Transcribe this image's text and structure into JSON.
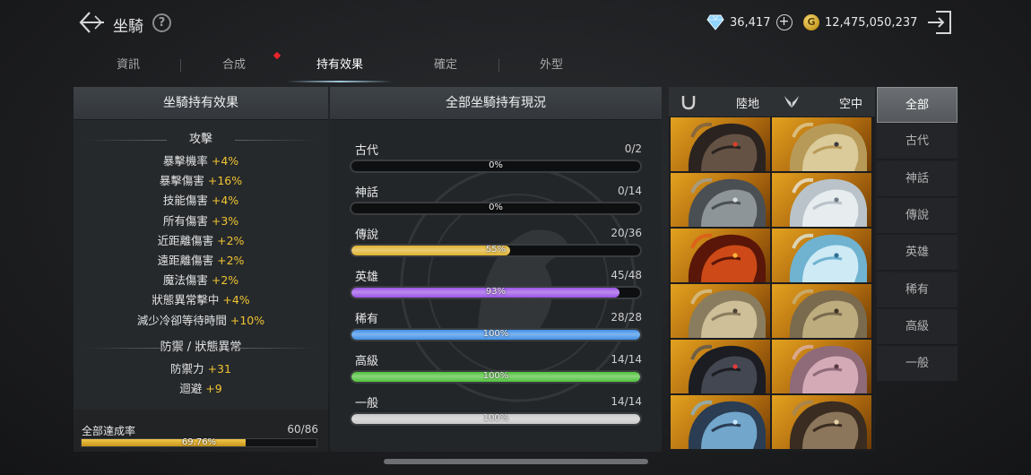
{
  "header": {
    "title": "坐騎",
    "help_symbol": "?",
    "diamond_value": "36,417",
    "gold_symbol": "G",
    "gold_value": "12,475,050,237"
  },
  "tabs": [
    {
      "label": "資訊"
    },
    {
      "label": "合成"
    },
    {
      "label": "持有效果"
    },
    {
      "label": "確定"
    },
    {
      "label": "外型"
    }
  ],
  "active_tab": "持有效果",
  "left_panel": {
    "title": "坐騎持有效果",
    "sections": [
      {
        "title": "攻擊",
        "stats": [
          {
            "name": "暴擊機率",
            "value": "+4%"
          },
          {
            "name": "暴擊傷害",
            "value": "+16%"
          },
          {
            "name": "技能傷害",
            "value": "+4%"
          },
          {
            "name": "所有傷害",
            "value": "+3%"
          },
          {
            "name": "近距離傷害",
            "value": "+2%"
          },
          {
            "name": "遠距離傷害",
            "value": "+2%"
          },
          {
            "name": "魔法傷害",
            "value": "+2%"
          },
          {
            "name": "狀態異常擊中",
            "value": "+4%"
          },
          {
            "name": "減少冷卻等待時間",
            "value": "+10%"
          }
        ]
      },
      {
        "title": "防禦 / 狀態異常",
        "stats": [
          {
            "name": "防禦力",
            "value": "+31"
          },
          {
            "name": "迴避",
            "value": "+9"
          }
        ]
      }
    ],
    "overall": {
      "label": "全部達成率",
      "count": "60/86",
      "percent_label": "69.76%",
      "fraction": 0.6976
    }
  },
  "center_panel": {
    "title": "全部坐騎持有現況",
    "grades": [
      {
        "name": "古代",
        "count": "0/2",
        "percent_label": "0%",
        "fraction": 0,
        "color": "#b8b8b8"
      },
      {
        "name": "神話",
        "count": "0/14",
        "percent_label": "0%",
        "fraction": 0,
        "color": "#b8b8b8"
      },
      {
        "name": "傳說",
        "count": "20/36",
        "percent_label": "55%",
        "fraction": 0.55,
        "color": "#e0b22e"
      },
      {
        "name": "英雄",
        "count": "45/48",
        "percent_label": "93%",
        "fraction": 0.93,
        "color": "#9a52e6"
      },
      {
        "name": "稀有",
        "count": "28/28",
        "percent_label": "100%",
        "fraction": 1,
        "color": "#3f8fe6"
      },
      {
        "name": "高級",
        "count": "14/14",
        "percent_label": "100%",
        "fraction": 1,
        "color": "#4fc23a"
      },
      {
        "name": "一般",
        "count": "14/14",
        "percent_label": "100%",
        "fraction": 1,
        "color": "#c9c9c9"
      }
    ]
  },
  "mount_panel": {
    "land_label": "陸地",
    "air_label": "空中",
    "land_icon": "horseshoe-icon",
    "air_icon": "wings-icon",
    "tiles": [
      {
        "name": "ram-mount-portrait",
        "hue": "dark-ram"
      },
      {
        "name": "shark-mount-portrait",
        "hue": "gold-shark"
      },
      {
        "name": "armored-beast-portrait",
        "hue": "steel"
      },
      {
        "name": "white-dragon-portrait",
        "hue": "white"
      },
      {
        "name": "fire-dragon-portrait",
        "hue": "fire"
      },
      {
        "name": "ice-lion-portrait",
        "hue": "ice"
      },
      {
        "name": "bone-beast-portrait",
        "hue": "bone"
      },
      {
        "name": "crowned-beast-portrait",
        "hue": "bone2"
      },
      {
        "name": "dark-horse-portrait",
        "hue": "dark-horse"
      },
      {
        "name": "pink-dragon-portrait",
        "hue": "pink"
      },
      {
        "name": "blue-horse-portrait",
        "hue": "blue-horse"
      },
      {
        "name": "airship-portrait",
        "hue": "airship"
      }
    ]
  },
  "categories": [
    {
      "label": "全部"
    },
    {
      "label": "古代"
    },
    {
      "label": "神話"
    },
    {
      "label": "傳說"
    },
    {
      "label": "英雄"
    },
    {
      "label": "稀有"
    },
    {
      "label": "高級"
    },
    {
      "label": "一般"
    }
  ],
  "active_category": "全部",
  "colors": {
    "accent_gold": "#f0c431",
    "panel_bg": "#26292c"
  }
}
